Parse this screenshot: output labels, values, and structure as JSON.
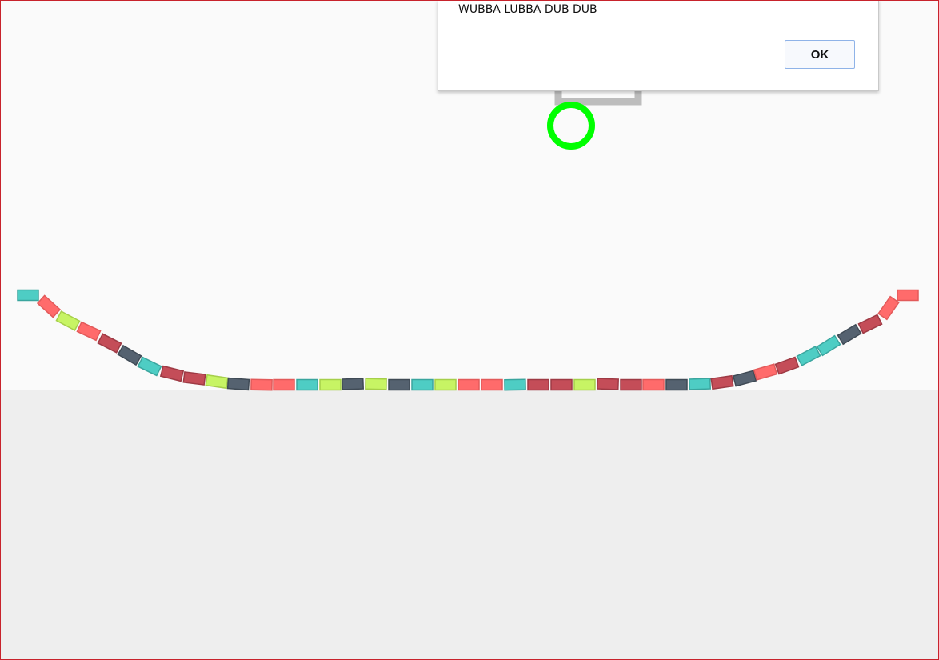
{
  "dialog": {
    "message": "WUBBA LUBBA DUB DUB",
    "ok_label": "OK"
  },
  "colors": {
    "page_background": "#fafafa",
    "ground": "#eeeeee",
    "frame_border": "#c8232c",
    "ring": "#00ff00",
    "anchor": "#bdbdbd",
    "block_palette": {
      "teal": "#4ecdc4",
      "salmon": "#ff6b6b",
      "lime": "#c7f464",
      "crimson": "#c44d58",
      "slate": "#556270"
    }
  },
  "rope": {
    "segment_colors": [
      "teal",
      "salmon",
      "lime",
      "salmon",
      "crimson",
      "slate",
      "teal",
      "crimson",
      "crimson",
      "lime",
      "slate",
      "salmon",
      "salmon",
      "teal",
      "lime",
      "slate",
      "lime",
      "slate",
      "teal",
      "lime",
      "salmon",
      "salmon",
      "teal",
      "crimson",
      "crimson",
      "lime",
      "crimson",
      "crimson",
      "salmon",
      "slate",
      "teal",
      "crimson",
      "slate",
      "salmon",
      "crimson",
      "teal",
      "teal",
      "slate",
      "crimson",
      "salmon",
      "salmon"
    ]
  }
}
